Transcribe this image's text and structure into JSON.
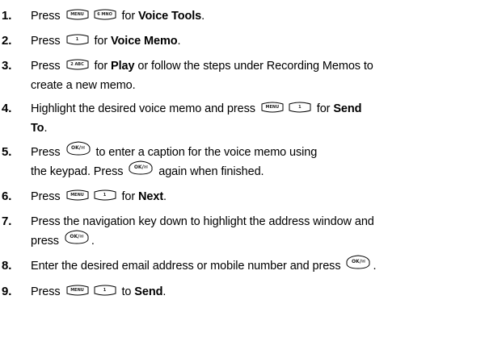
{
  "key_labels": {
    "menu": "MENU",
    "six": "6 MNO",
    "one": "1",
    "two": "2 ABC",
    "ok": "OK/✉"
  },
  "steps": [
    {
      "num": "1.",
      "a": "Press",
      "b": "for",
      "c": "Voice Tools",
      "d": "."
    },
    {
      "num": "2.",
      "a": "Press",
      "b": "for",
      "c": "Voice Memo",
      "d": "."
    },
    {
      "num": "3.",
      "a": "Press",
      "b": "for",
      "c": "Play",
      "d": "or follow the steps under Recording Memos to",
      "e": "create a new memo."
    },
    {
      "num": "4.",
      "a": "Highlight the desired voice memo and press",
      "b": "for",
      "c": "Send",
      "d": "To",
      "e": "."
    },
    {
      "num": "5.",
      "a": "Press",
      "b": "to enter a caption for the voice memo using",
      "c": "the keypad. Press",
      "d": "again when finished."
    },
    {
      "num": "6.",
      "a": "Press",
      "b": "for",
      "c": "Next",
      "d": "."
    },
    {
      "num": "7.",
      "a": "Press the navigation key down to highlight the address window and",
      "b": "press",
      "c": "."
    },
    {
      "num": "8.",
      "a": "Enter the desired email address or mobile number and press",
      "b": "."
    },
    {
      "num": "9.",
      "a": "Press",
      "b": "to",
      "c": "Send",
      "d": "."
    }
  ]
}
